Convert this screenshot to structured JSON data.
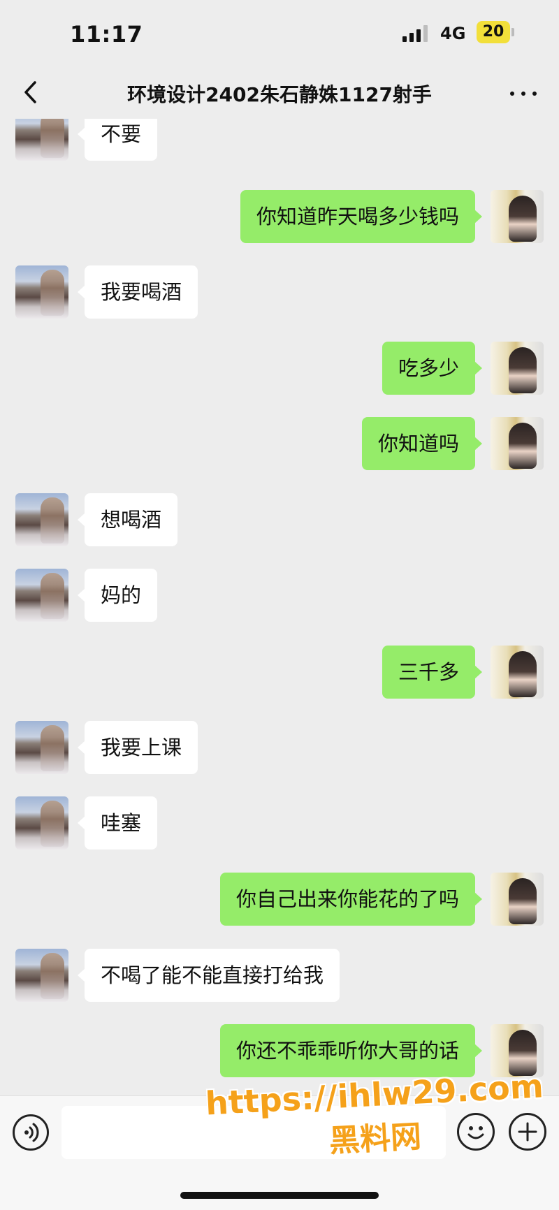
{
  "status_bar": {
    "time": "11:17",
    "network": "4G",
    "battery": "20"
  },
  "header": {
    "title": "环境设计2402朱石静姝1127射手"
  },
  "messages": [
    {
      "direction": "in",
      "text": "不要"
    },
    {
      "direction": "out",
      "text": "你知道昨天喝多少钱吗"
    },
    {
      "direction": "in",
      "text": "我要喝酒"
    },
    {
      "direction": "out",
      "text": "吃多少"
    },
    {
      "direction": "out",
      "text": "你知道吗"
    },
    {
      "direction": "in",
      "text": "想喝酒"
    },
    {
      "direction": "in",
      "text": "妈的"
    },
    {
      "direction": "out",
      "text": "三千多"
    },
    {
      "direction": "in",
      "text": "我要上课"
    },
    {
      "direction": "in",
      "text": "哇塞"
    },
    {
      "direction": "out",
      "text": "你自己出来你能花的了吗"
    },
    {
      "direction": "in",
      "text": "不喝了能不能直接打给我"
    },
    {
      "direction": "out",
      "text": "你还不乖乖听你大哥的话"
    }
  ],
  "input_bar": {
    "value": ""
  },
  "watermark": {
    "url": "https://ihlw29.com",
    "site": "黑料网"
  },
  "colors": {
    "background": "#ededed",
    "outgoing_bubble": "#95ec69",
    "incoming_bubble": "#ffffff",
    "battery": "#f2df3a",
    "watermark": "#f5a11a"
  },
  "icons": [
    "back-chevron-icon",
    "more-dots-icon",
    "voice-icon",
    "emoji-icon",
    "plus-icon",
    "signal-icon"
  ]
}
